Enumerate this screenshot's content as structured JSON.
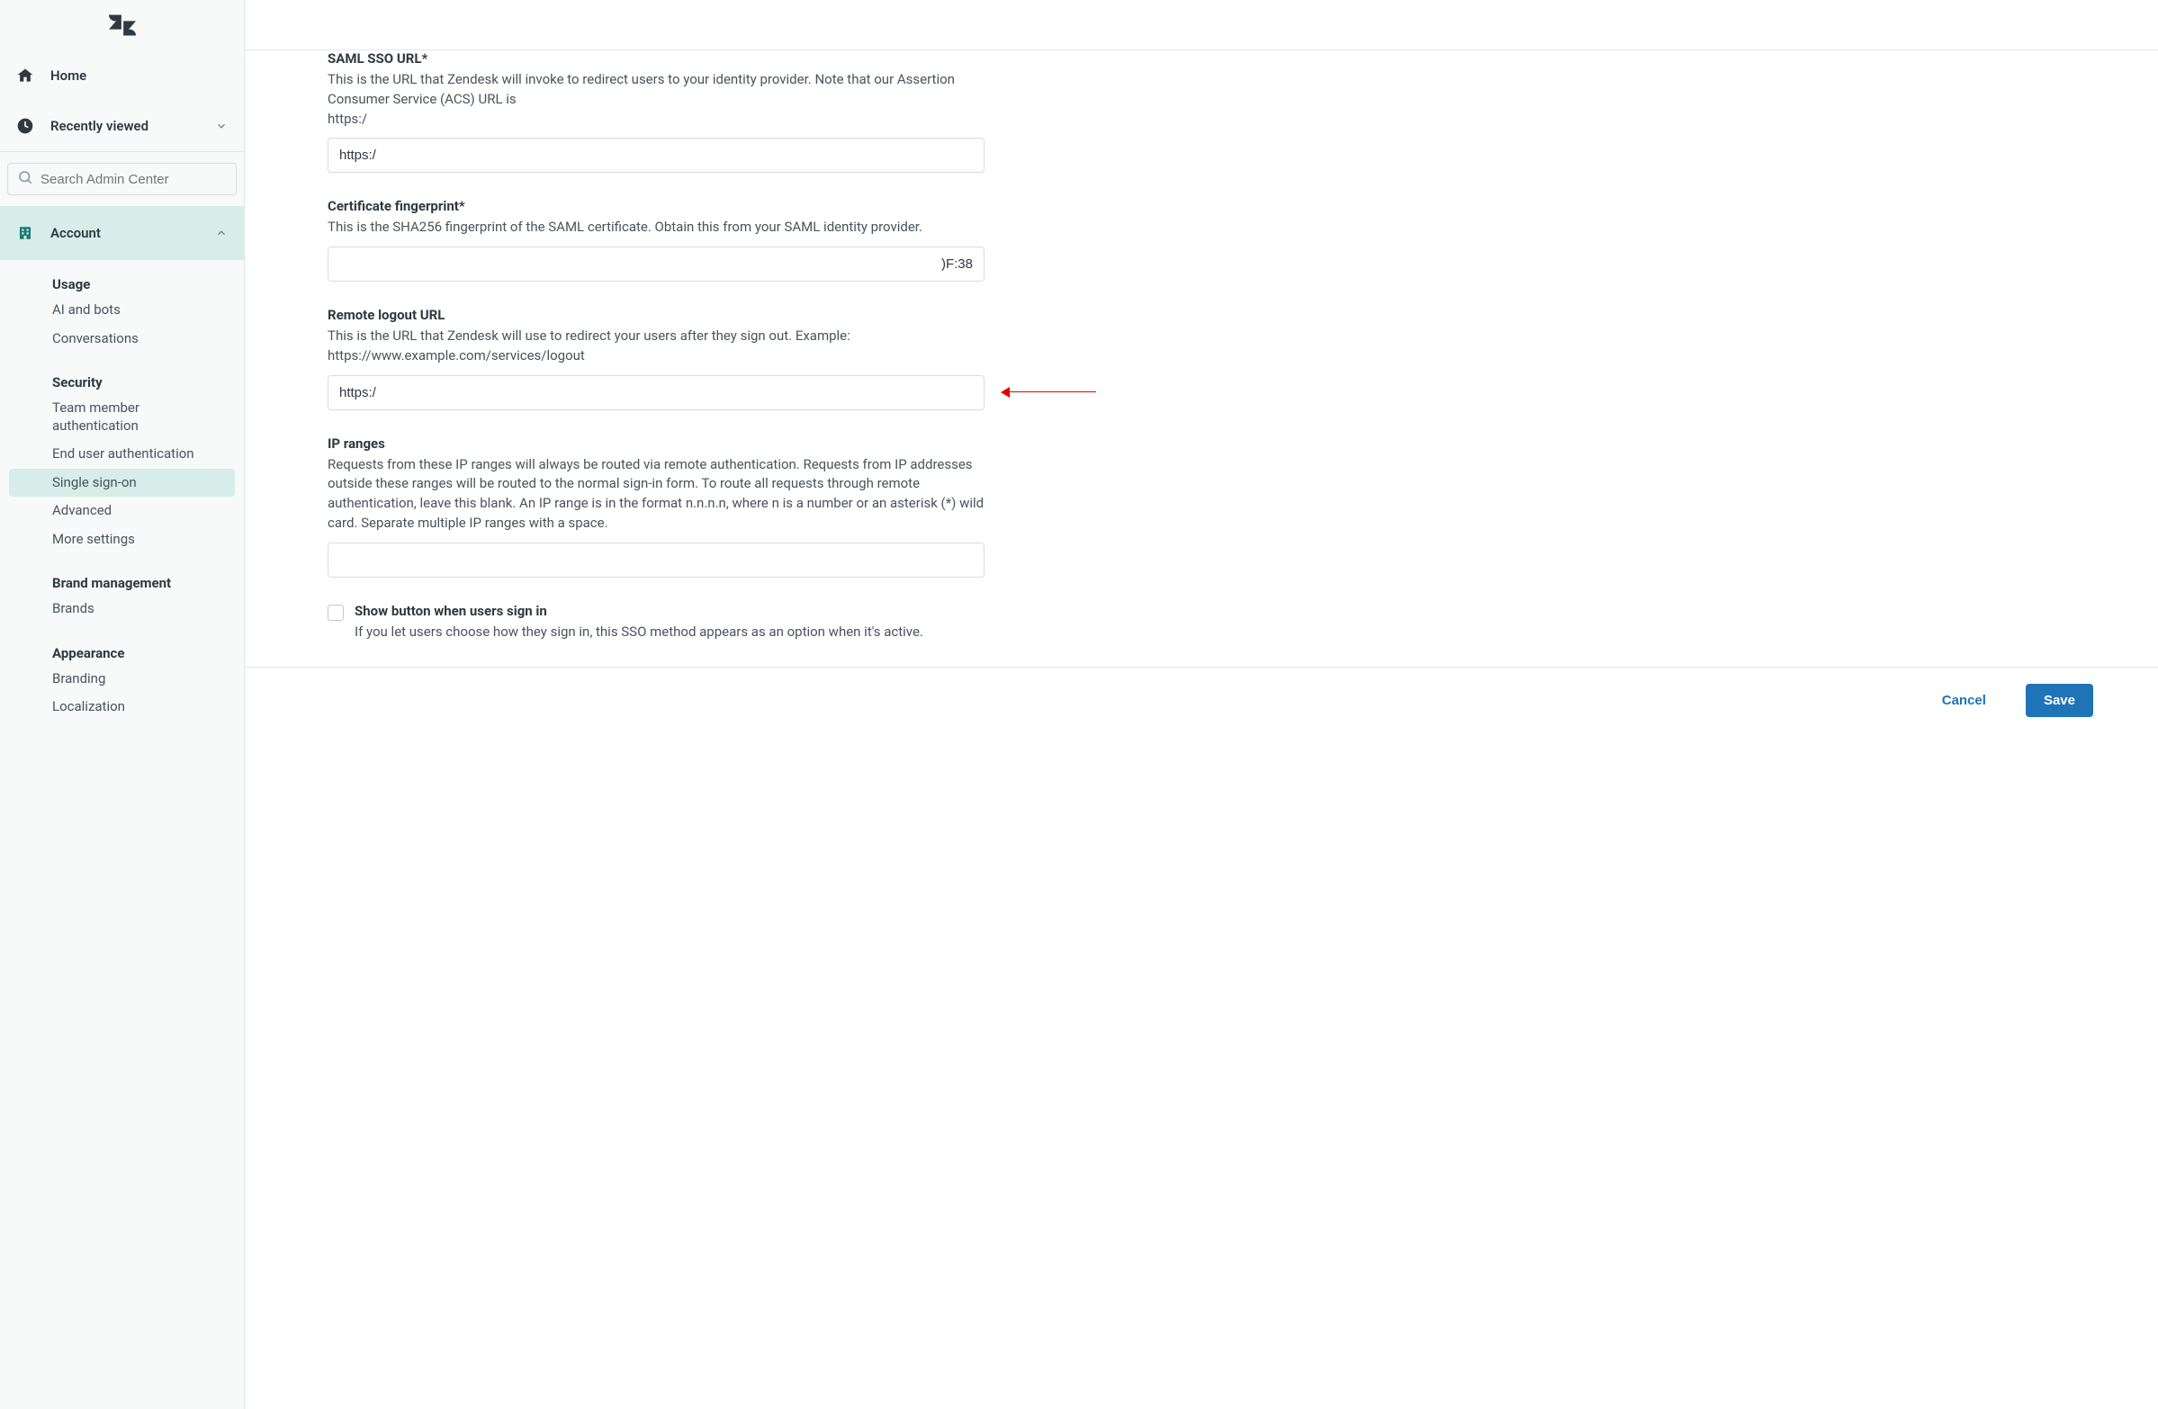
{
  "sidebar": {
    "nav": {
      "home_label": "Home",
      "recent_label": "Recently viewed"
    },
    "search": {
      "placeholder": "Search Admin Center"
    },
    "sections": {
      "account_label": "Account"
    },
    "groups": [
      {
        "heading": "Usage",
        "items": [
          {
            "label": "AI and bots"
          },
          {
            "label": "Conversations"
          }
        ]
      },
      {
        "heading": "Security",
        "items": [
          {
            "label": "Team member authentication"
          },
          {
            "label": "End user authentication"
          },
          {
            "label": "Single sign-on",
            "selected": true
          },
          {
            "label": "Advanced"
          },
          {
            "label": "More settings"
          }
        ]
      },
      {
        "heading": "Brand management",
        "items": [
          {
            "label": "Brands"
          }
        ]
      },
      {
        "heading": "Appearance",
        "items": [
          {
            "label": "Branding"
          },
          {
            "label": "Localization"
          }
        ]
      }
    ]
  },
  "form": {
    "saml_sso_url": {
      "label": "SAML SSO URL*",
      "help": "This is the URL that Zendesk will invoke to redirect users to your identity provider. Note that our Assertion Consumer Service (ACS) URL is",
      "help_line2": "https:/",
      "value": "https:/"
    },
    "cert_fingerprint": {
      "label": "Certificate fingerprint*",
      "help": "This is the SHA256 fingerprint of the SAML certificate. Obtain this from your SAML identity provider.",
      "value": ")F:38"
    },
    "remote_logout": {
      "label": "Remote logout URL",
      "help": "This is the URL that Zendesk will use to redirect your users after they sign out. Example: https://www.example.com/services/logout",
      "value": "https:/"
    },
    "ip_ranges": {
      "label": "IP ranges",
      "help": "Requests from these IP ranges will always be routed via remote authentication. Requests from IP addresses outside these ranges will be routed to the normal sign-in form. To route all requests through remote authentication, leave this blank. An IP range is in the format n.n.n.n, where n is a number or an asterisk (*) wild card. Separate multiple IP ranges with a space.",
      "value": ""
    },
    "show_button": {
      "label": "Show button when users sign in",
      "help": "If you let users choose how they sign in, this SSO method appears as an option when it's active."
    }
  },
  "footer": {
    "cancel_label": "Cancel",
    "save_label": "Save"
  }
}
